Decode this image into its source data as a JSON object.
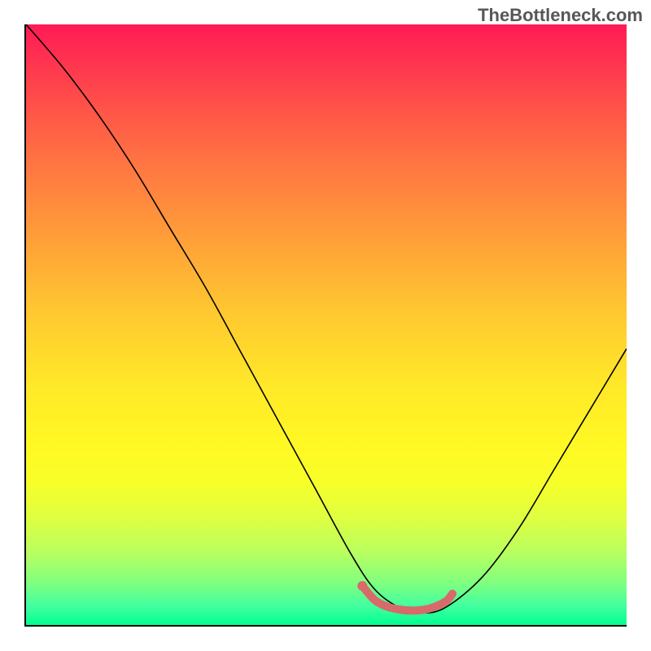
{
  "watermark": "TheBottleneck.com",
  "chart_data": {
    "type": "line",
    "title": "",
    "xlabel": "",
    "ylabel": "",
    "xlim": [
      0,
      100
    ],
    "ylim": [
      0,
      100
    ],
    "series": [
      {
        "name": "bottleneck-curve",
        "color": "#000000",
        "x": [
          0,
          6,
          12,
          18,
          24,
          30,
          36,
          42,
          48,
          54,
          58,
          62,
          66,
          70,
          76,
          82,
          88,
          94,
          100
        ],
        "y": [
          100,
          93,
          85,
          76,
          66,
          56,
          45,
          34,
          23,
          12,
          6,
          3,
          2,
          3,
          8,
          16,
          26,
          36,
          46
        ]
      },
      {
        "name": "optimal-range-marker",
        "color": "#d86a6a",
        "x": [
          56,
          58,
          60,
          62,
          64,
          66,
          68,
          70,
          71
        ],
        "y": [
          6.5,
          4.2,
          3.1,
          2.6,
          2.4,
          2.5,
          3.0,
          4.0,
          5.2
        ]
      }
    ],
    "optimal_point": {
      "x": 64,
      "y": 2.4
    },
    "annotations": []
  }
}
